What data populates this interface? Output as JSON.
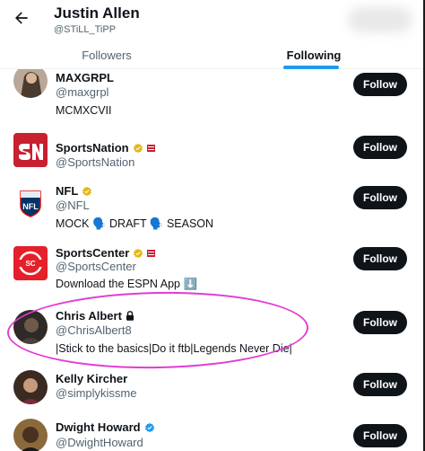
{
  "header": {
    "title": "Justin Allen",
    "handle": "@STiLL_TiPP"
  },
  "tabs": [
    {
      "label": "Followers",
      "active": false
    },
    {
      "label": "Following",
      "active": true
    }
  ],
  "follow_label": "Follow",
  "users": [
    {
      "name": "MAXGRPL",
      "handle": "@maxgrpl",
      "bio": "MCMXCVII"
    },
    {
      "name": "SportsNation",
      "handle": "@SportsNation",
      "bio": "",
      "badge": "gold",
      "affiliate": true
    },
    {
      "name": "NFL",
      "handle": "@NFL",
      "bio": "MOCK 🗣️ DRAFT 🗣️ SEASON",
      "badge": "gold"
    },
    {
      "name": "SportsCenter",
      "handle": "@SportsCenter",
      "bio": "Download the ESPN App ⬇️",
      "badge": "gold",
      "affiliate": true
    },
    {
      "name": "Chris Albert",
      "handle": "@ChrisAlbert8",
      "bio": "|Stick to the basics|Do it ftb|Legends Never Die|",
      "protected": true
    },
    {
      "name": "Kelly Kircher",
      "handle": "@simplykissme",
      "bio": ""
    },
    {
      "name": "Dwight Howard",
      "handle": "@DwightHoward",
      "bio": "",
      "badge": "blue"
    }
  ],
  "colors": {
    "accent": "#1d9bf0",
    "gold_badge": "#e2b719",
    "follow_button": "#0f1419",
    "highlight_annotation": "#e23bd5",
    "sportsnation_brand": "#c8202f",
    "sportscenter_brand": "#e4202b"
  }
}
